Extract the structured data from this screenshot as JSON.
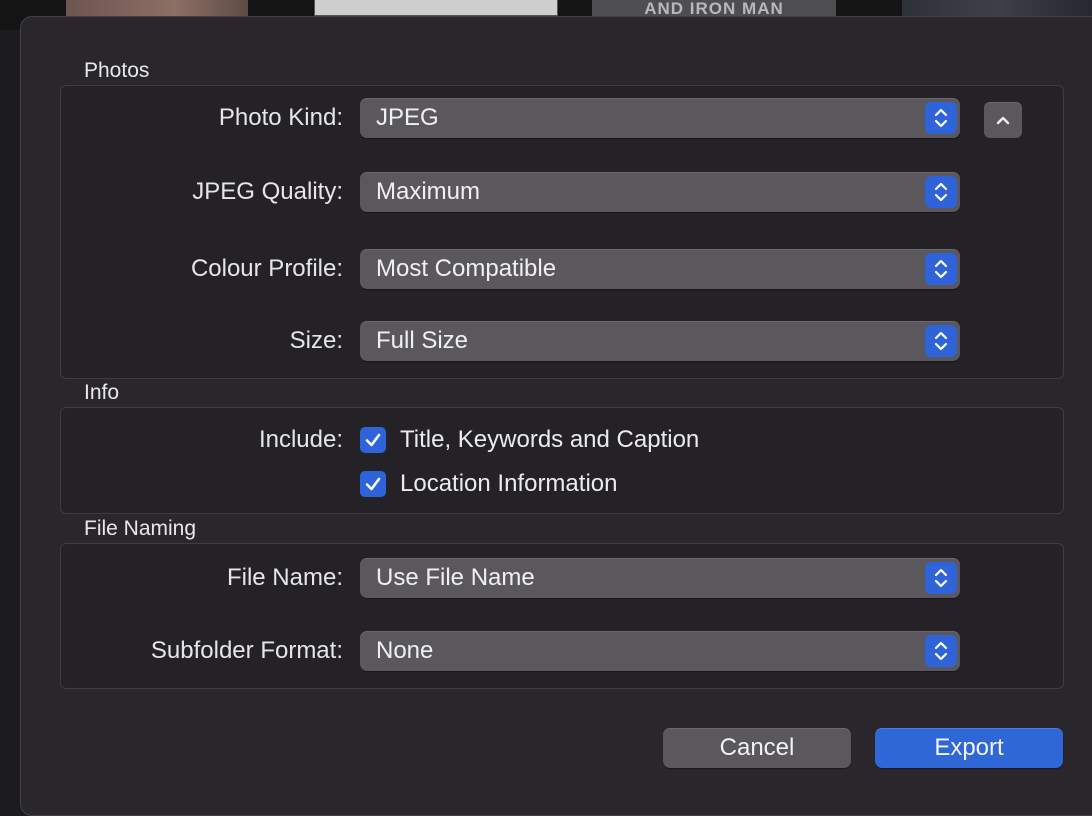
{
  "background": {
    "thumbnail_text": "AND IRON MAN"
  },
  "photos_section": {
    "title": "Photos",
    "photo_kind": {
      "label": "Photo Kind:",
      "value": "JPEG"
    },
    "jpeg_quality": {
      "label": "JPEG Quality:",
      "value": "Maximum"
    },
    "colour_profile": {
      "label": "Colour Profile:",
      "value": "Most Compatible"
    },
    "size": {
      "label": "Size:",
      "value": "Full Size"
    },
    "collapse_icon": "chevron-up-icon"
  },
  "info_section": {
    "title": "Info",
    "include_label": "Include:",
    "options": [
      {
        "label": "Title, Keywords and Caption",
        "checked": true
      },
      {
        "label": "Location Information",
        "checked": true
      }
    ]
  },
  "file_naming_section": {
    "title": "File Naming",
    "file_name": {
      "label": "File Name:",
      "value": "Use File Name"
    },
    "subfolder_format": {
      "label": "Subfolder Format:",
      "value": "None"
    }
  },
  "buttons": {
    "cancel": "Cancel",
    "export": "Export"
  },
  "colors": {
    "accent": "#2f63d9",
    "sheet_background": "#29272c",
    "control_background": "#5a585d"
  }
}
